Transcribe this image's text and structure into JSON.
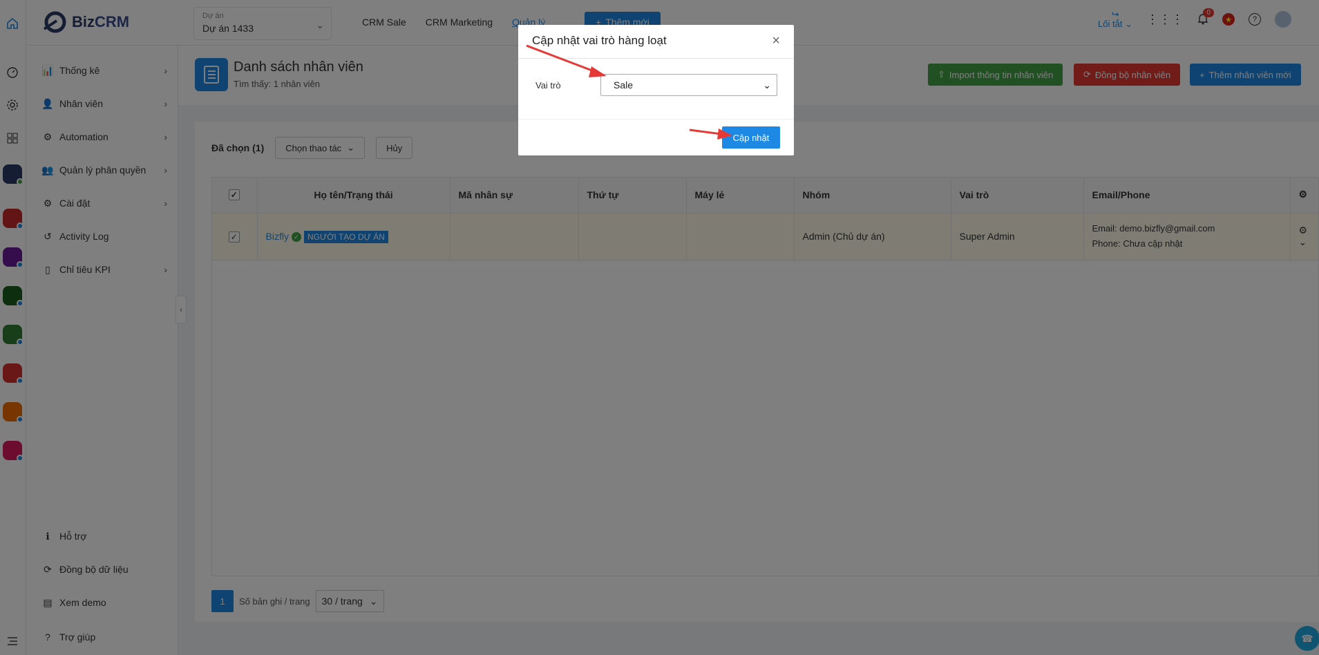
{
  "header": {
    "logo_text_a": "Biz",
    "logo_text_b": "CRM",
    "project_label": "Dự án",
    "project_value": "Dự án 1433",
    "nav": [
      "CRM Sale",
      "CRM Marketing",
      "Quản lý"
    ],
    "add_new_label": "Thêm mới",
    "shortcut_label": "Lối tắt",
    "notification_count": "0"
  },
  "sidebar": {
    "items": [
      {
        "label": "Thống kê",
        "icon": "chart-icon"
      },
      {
        "label": "Nhân viên",
        "icon": "user-icon"
      },
      {
        "label": "Automation",
        "icon": "automation-icon"
      },
      {
        "label": "Quản lý phân quyền",
        "icon": "permission-icon"
      },
      {
        "label": "Cài đặt",
        "icon": "gear-icon"
      },
      {
        "label": "Activity Log",
        "icon": "history-icon"
      },
      {
        "label": "Chỉ tiêu KPI",
        "icon": "kpi-icon"
      }
    ],
    "bottom": [
      {
        "label": "Hỗ trợ",
        "icon": "info-icon"
      },
      {
        "label": "Đồng bộ dữ liệu",
        "icon": "sync-icon"
      },
      {
        "label": "Xem demo",
        "icon": "demo-icon"
      },
      {
        "label": "Trợ giúp",
        "icon": "help-icon"
      }
    ]
  },
  "page": {
    "title": "Danh sách nhân viên",
    "found": "Tìm thấy: 1 nhân viên",
    "import_label": "Import thông tin nhân viên",
    "sync_label": "Đồng bộ nhân viên",
    "add_label": "Thêm nhân viên mới"
  },
  "toolbar": {
    "selected": "Đã chọn (1)",
    "action_label": "Chọn thao tác",
    "cancel_label": "Hủy"
  },
  "table": {
    "columns": [
      "Họ tên/Trạng thái",
      "Mã nhân sự",
      "Thứ tự",
      "Máy lẻ",
      "Nhóm",
      "Vai trò",
      "Email/Phone"
    ],
    "rows": [
      {
        "name": "Bizfly",
        "tag": "NGƯỜI TẠO DỰ ÁN",
        "code": "",
        "order": "",
        "ext": "",
        "group": "Admin (Chủ dự án)",
        "role": "Super Admin",
        "email": "Email: demo.bizfly@gmail.com",
        "phone": "Phone: Chưa cập nhật"
      }
    ]
  },
  "pager": {
    "page": "1",
    "per_page_label": "Số bản ghi / trang",
    "per_page_value": "30 / trang"
  },
  "modal": {
    "title": "Cập nhật vai trò hàng loạt",
    "role_label": "Vai trò",
    "role_value": "Sale",
    "submit_label": "Cập nhật"
  },
  "colors": {
    "primary": "#1e88e5",
    "green": "#43a047",
    "red": "#e53935",
    "arrow": "#e53935"
  }
}
